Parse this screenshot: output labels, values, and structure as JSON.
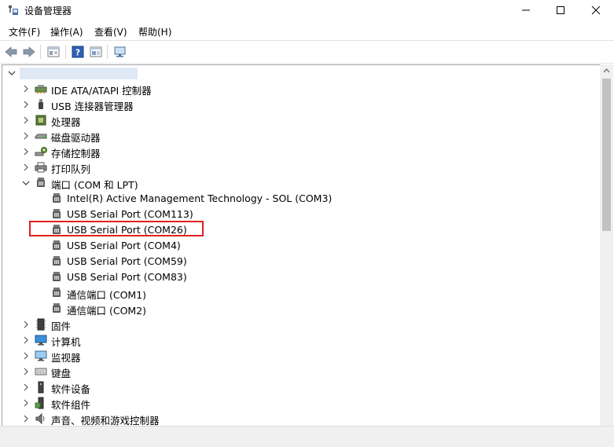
{
  "window": {
    "title": "设备管理器",
    "min_glyph": "—",
    "max_glyph": "☐",
    "close_glyph": "✕"
  },
  "menu": [
    {
      "label": "文件(F)"
    },
    {
      "label": "操作(A)"
    },
    {
      "label": "查看(V)"
    },
    {
      "label": "帮助(H)"
    }
  ],
  "toolbar": {
    "back_icon": "back-arrow-icon",
    "forward_icon": "forward-arrow-icon",
    "properties_icon": "properties-icon",
    "help_icon": "help-icon",
    "view_icon": "view-icon",
    "monitor_icon": "scan-hardware-icon"
  },
  "tree": {
    "root_label": "",
    "categories": [
      {
        "label": "IDE ATA/ATAPI 控制器",
        "icon": "ide-controller-icon",
        "expanded": false
      },
      {
        "label": "USB 连接器管理器",
        "icon": "usb-connector-icon",
        "expanded": false
      },
      {
        "label": "处理器",
        "icon": "processor-icon",
        "expanded": false
      },
      {
        "label": "磁盘驱动器",
        "icon": "disk-drive-icon",
        "expanded": false
      },
      {
        "label": "存储控制器",
        "icon": "storage-controller-icon",
        "expanded": false
      },
      {
        "label": "打印队列",
        "icon": "printer-icon",
        "expanded": false
      },
      {
        "label": "端口 (COM 和 LPT)",
        "icon": "port-icon",
        "expanded": true
      }
    ],
    "ports": [
      {
        "label": "Intel(R) Active Management Technology - SOL (COM3)"
      },
      {
        "label": "USB Serial Port (COM113)"
      },
      {
        "label": "USB Serial Port (COM26)"
      },
      {
        "label": "USB Serial Port (COM4)"
      },
      {
        "label": "USB Serial Port (COM59)"
      },
      {
        "label": "USB Serial Port (COM83)"
      },
      {
        "label": "通信端口 (COM1)"
      },
      {
        "label": "通信端口 (COM2)"
      }
    ],
    "more_categories": [
      {
        "label": "固件",
        "icon": "firmware-icon"
      },
      {
        "label": "计算机",
        "icon": "computer-icon"
      },
      {
        "label": "监视器",
        "icon": "monitor-icon"
      },
      {
        "label": "键盘",
        "icon": "keyboard-icon"
      },
      {
        "label": "软件设备",
        "icon": "software-device-icon"
      },
      {
        "label": "软件组件",
        "icon": "software-component-icon"
      },
      {
        "label": "声音、视频和游戏控制器",
        "icon": "sound-icon"
      }
    ]
  },
  "colors": {
    "highlight_border": "#e02020",
    "selection": "#dfe9f5"
  }
}
